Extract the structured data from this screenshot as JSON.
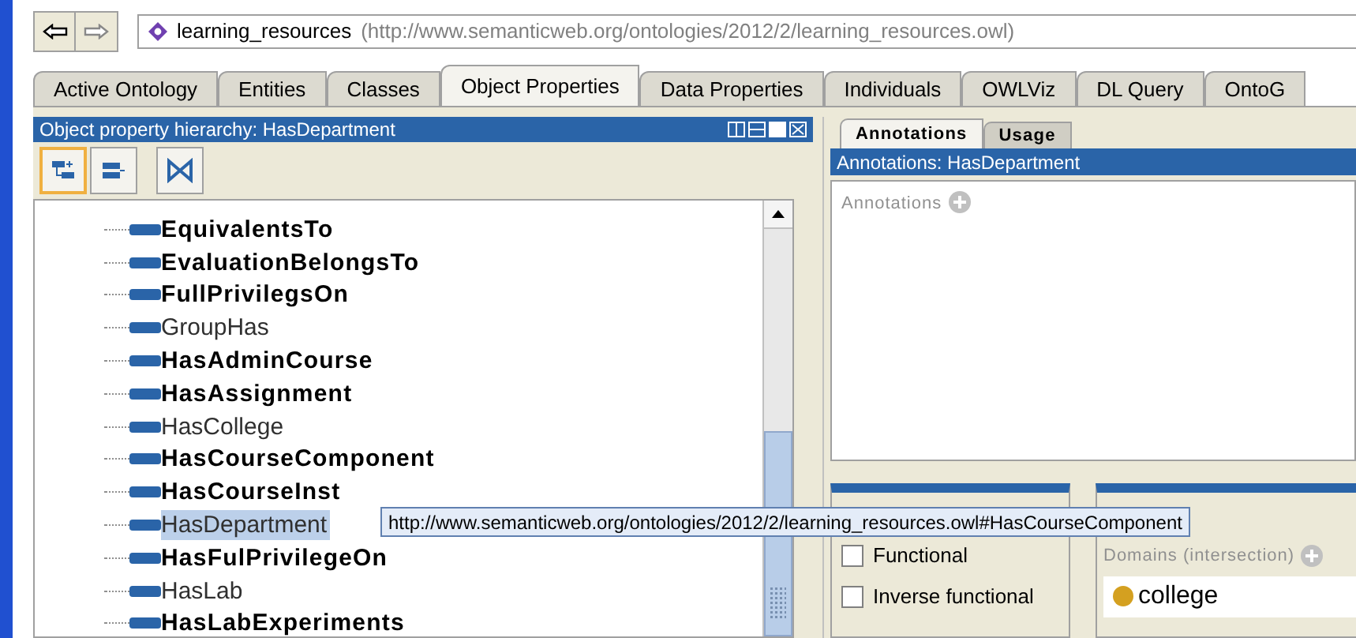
{
  "address": {
    "name": "learning_resources",
    "iri": "(http://www.semanticweb.org/ontologies/2012/2/learning_resources.owl)"
  },
  "tabs": [
    {
      "label": "Active Ontology",
      "selected": false
    },
    {
      "label": "Entities",
      "selected": false
    },
    {
      "label": "Classes",
      "selected": false
    },
    {
      "label": "Object Properties",
      "selected": true
    },
    {
      "label": "Data Properties",
      "selected": false
    },
    {
      "label": "Individuals",
      "selected": false
    },
    {
      "label": "OWLViz",
      "selected": false
    },
    {
      "label": "DL Query",
      "selected": false
    },
    {
      "label": "OntoG",
      "selected": false
    }
  ],
  "hierarchy": {
    "title": "Object property hierarchy: HasDepartment",
    "toolbar": [
      {
        "kind": "add-sub",
        "selected": true
      },
      {
        "kind": "add-sibling",
        "selected": false
      },
      {
        "kind": "delete",
        "selected": false
      }
    ],
    "items": [
      {
        "label": "EquivalentsTo",
        "bold": true,
        "selected": false
      },
      {
        "label": "EvaluationBelongsTo",
        "bold": true,
        "selected": false
      },
      {
        "label": "FullPrivilegsOn",
        "bold": true,
        "selected": false
      },
      {
        "label": "GroupHas",
        "bold": false,
        "selected": false
      },
      {
        "label": "HasAdminCourse",
        "bold": true,
        "selected": false
      },
      {
        "label": "HasAssignment",
        "bold": true,
        "selected": false
      },
      {
        "label": "HasCollege",
        "bold": false,
        "selected": false
      },
      {
        "label": "HasCourseComponent",
        "bold": true,
        "selected": false
      },
      {
        "label": "HasCourseInst",
        "bold": true,
        "selected": false
      },
      {
        "label": "HasDepartment",
        "bold": false,
        "selected": true
      },
      {
        "label": "HasFulPrivilegeOn",
        "bold": true,
        "selected": false
      },
      {
        "label": "HasLab",
        "bold": false,
        "selected": false
      },
      {
        "label": "HasLabExperiments",
        "bold": true,
        "selected": false
      }
    ]
  },
  "detail_tabs": [
    {
      "label": "Annotations",
      "selected": true
    },
    {
      "label": "Usage",
      "selected": false
    }
  ],
  "annotations": {
    "title": "Annotations: HasDepartment",
    "section": "Annotations"
  },
  "characteristics": [
    {
      "label": "Functional",
      "checked": false
    },
    {
      "label": "Inverse functional",
      "checked": false
    }
  ],
  "domains": {
    "title": "Domains (intersection)",
    "items": [
      {
        "label": "college",
        "color": "#d4a020"
      }
    ]
  },
  "tooltip": "http://www.semanticweb.org/ontologies/2012/2/learning_resources.owl#HasCourseComponent"
}
